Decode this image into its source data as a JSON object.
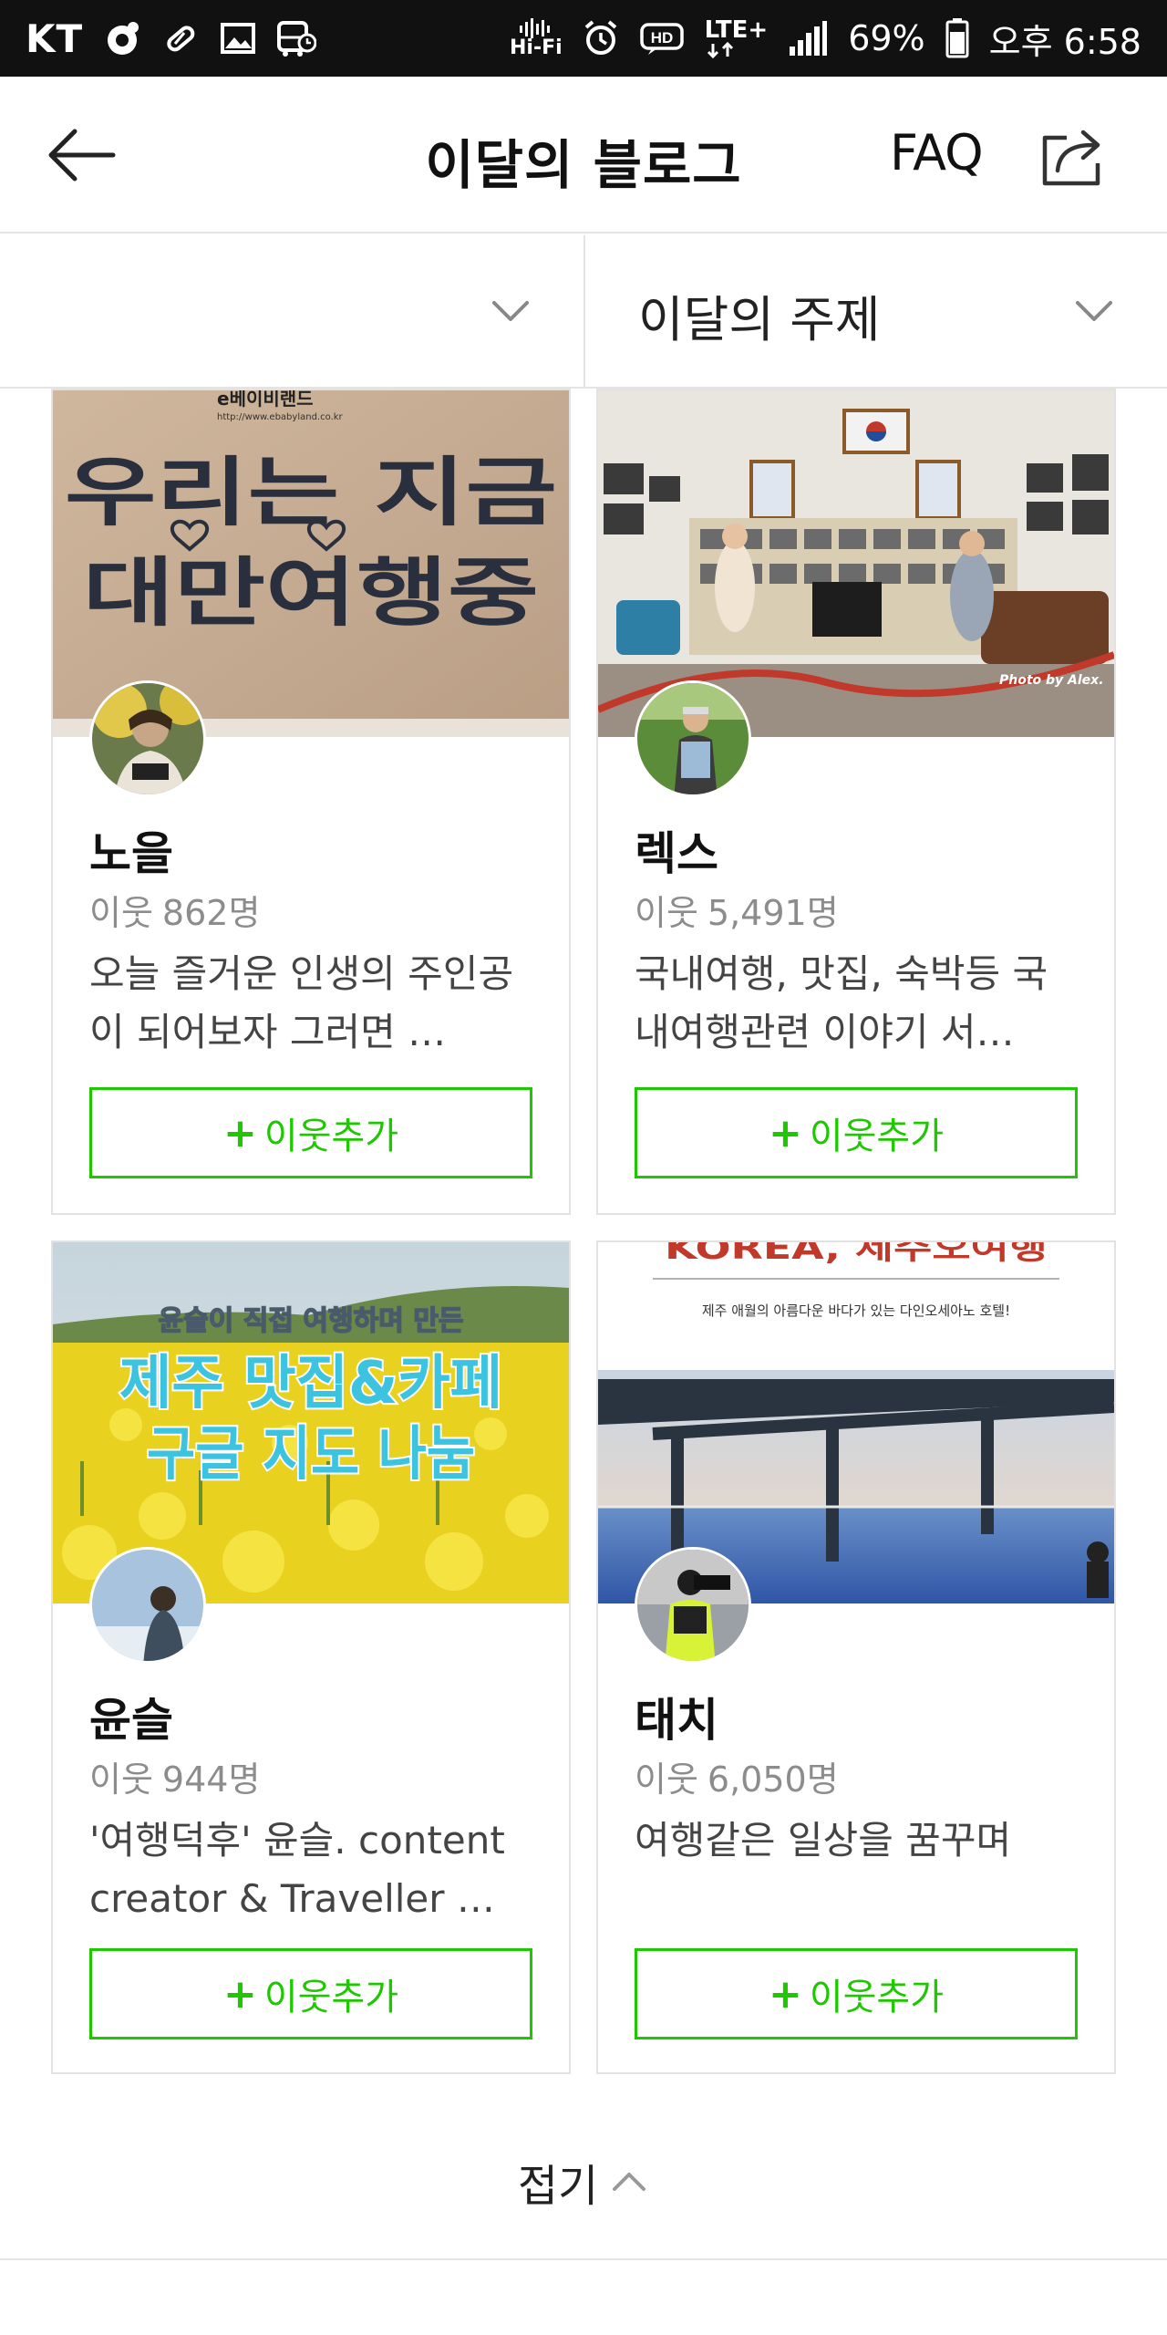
{
  "status_bar": {
    "carrier": "KT",
    "hifi_label": "Hi-Fi",
    "hd_label": "HD",
    "lte_label": "LTE+",
    "battery": "69%",
    "time": "오후 6:58"
  },
  "header": {
    "title": "이달의 블로그",
    "faq_label": "FAQ"
  },
  "filters": {
    "left_label": "",
    "right_label": "이달의 주제"
  },
  "blogs": [
    {
      "name": "노을",
      "neighbors_prefix": "이웃",
      "neighbors_count": "862명",
      "description": "오늘 즐거운 인생의 주인공이 되어보자 그러면 …",
      "follow_label": "이웃추가",
      "image_text_top": "e베이비랜드",
      "image_text_url": "http://www.ebabyland.co.kr",
      "image_text_main": "우리는 지금 대만여행중"
    },
    {
      "name": "렉스",
      "neighbors_prefix": "이웃",
      "neighbors_count": "5,491명",
      "description": "국내여행, 맛집, 숙박등 국내여행관련 이야기 서…",
      "follow_label": "이웃추가",
      "image_text_credit": "Photo by Alex."
    },
    {
      "name": "윤슬",
      "neighbors_prefix": "이웃",
      "neighbors_count": "944명",
      "description": "'여행덕후' 윤슬. content creator & Traveller …",
      "follow_label": "이웃추가",
      "image_text_sub": "윤슬이 직접 여행하며 만든",
      "image_text_line1": "제주 맛집&카페",
      "image_text_line2": "구글 지도 나눔"
    },
    {
      "name": "태치",
      "neighbors_prefix": "이웃",
      "neighbors_count": "6,050명",
      "description": "여행같은 일상을 꿈꾸며",
      "follow_label": "이웃추가",
      "image_text_top": "KOREA, 제주오여행",
      "image_text_sub": "제주 애월의 아름다운 바다가 있는 다인오세아노 호텔!"
    }
  ],
  "collapse_label": "접기",
  "colors": {
    "accent_green": "#1ec800",
    "status_bar_bg": "#111111"
  }
}
